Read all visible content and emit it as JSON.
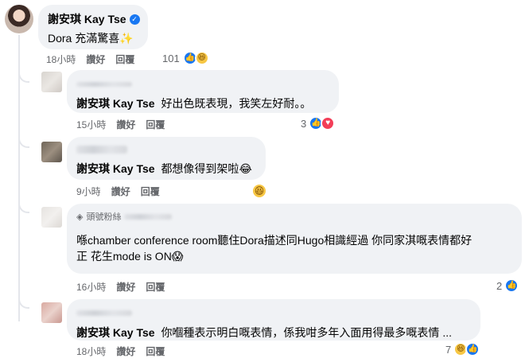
{
  "main_comment": {
    "author": "謝安琪 Kay Tse",
    "text": "Dora 充滿驚喜",
    "sparkle": "✨",
    "time": "18小時",
    "like_label": "讚好",
    "reply_label": "回覆",
    "reaction_count": "101"
  },
  "replies": [
    {
      "author": "謝安琪 Kay Tse",
      "text": "好出色既表現，我笑左好耐。。",
      "time": "15小時",
      "like_label": "讚好",
      "reply_label": "回覆",
      "reaction_count": "3"
    },
    {
      "author": "謝安琪 Kay Tse",
      "text": "都想像得到架啦",
      "emoji": "😂",
      "time": "9小時",
      "like_label": "讚好",
      "reply_label": "回覆"
    },
    {
      "badge": "頭號粉絲",
      "text_line1": "喺chamber conference room聽住Dora描述同Hugo相識經過 你同家淇嘅表情都好",
      "text_line2": "正 花生mode is ON",
      "emoji": "😱",
      "time": "16小時",
      "like_label": "讚好",
      "reply_label": "回覆",
      "reaction_count": "2"
    },
    {
      "author": "謝安琪 Kay Tse",
      "text": "你嗰種表示明白嘅表情，係我咁多年入面用得最多嘅表情 ...",
      "time": "18小時",
      "like_label": "讚好",
      "reply_label": "回覆",
      "reaction_count": "7"
    }
  ],
  "colors": {
    "like_blue": "#1877f2",
    "bubble_bg": "#f0f2f5",
    "meta_gray": "#65676b",
    "haha_yellow": "#f7c744",
    "love_red": "#f33e58"
  }
}
